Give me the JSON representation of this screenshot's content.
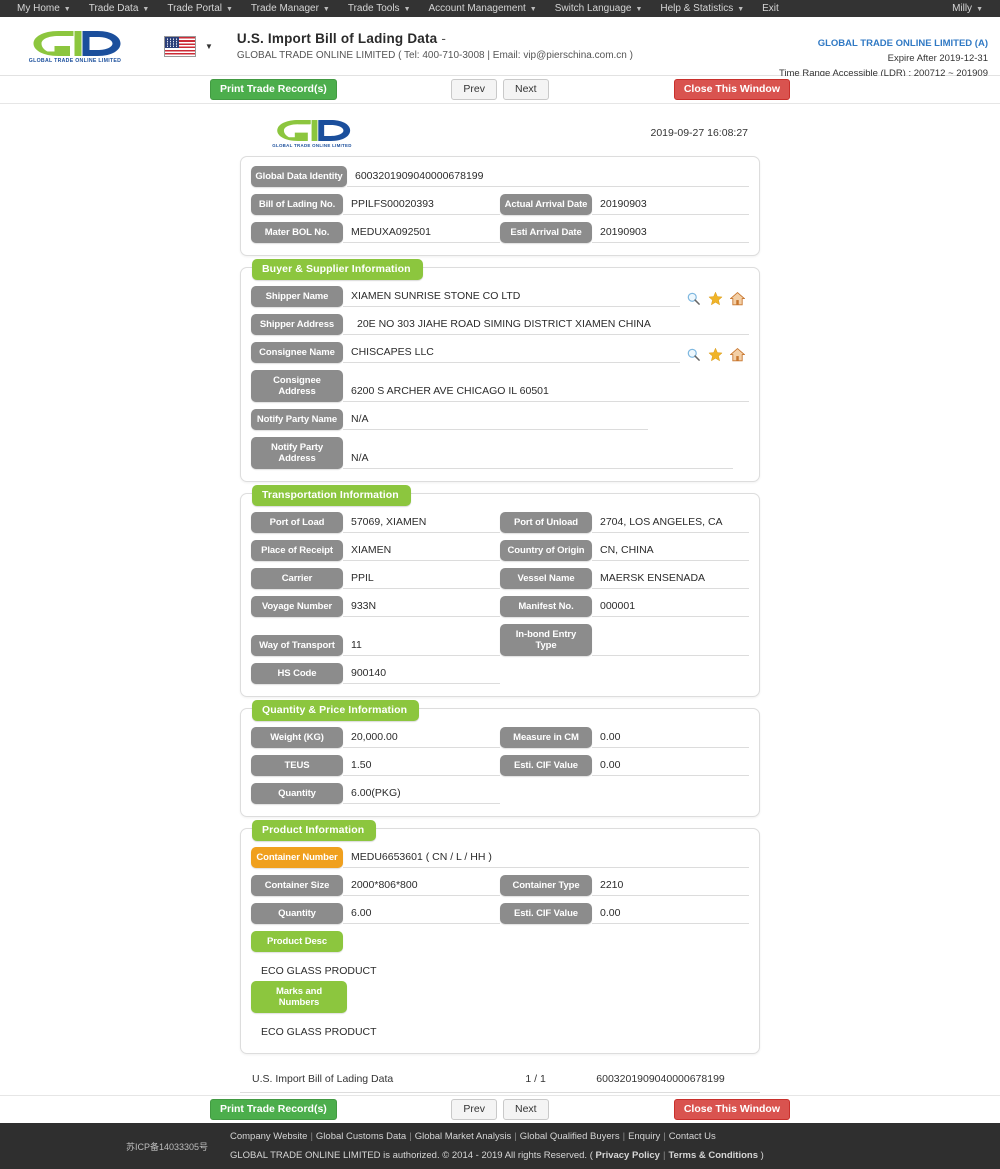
{
  "topnav": {
    "items": [
      {
        "label": "My Home",
        "caret": true
      },
      {
        "label": "Trade Data",
        "caret": true
      },
      {
        "label": "Trade Portal",
        "caret": true
      },
      {
        "label": "Trade Manager",
        "caret": true
      },
      {
        "label": "Trade Tools",
        "caret": true
      },
      {
        "label": "Account Management",
        "caret": true
      },
      {
        "label": "Switch Language",
        "caret": true
      },
      {
        "label": "Help & Statistics",
        "caret": true
      },
      {
        "label": "Exit",
        "caret": false
      }
    ],
    "user": "Milly"
  },
  "header": {
    "logo_sub": "GLOBAL TRADE  ONLINE LIMITED",
    "flag": "us-flag-icon",
    "title": "U.S. Import Bill of Lading Data",
    "title_dash": "-",
    "subtitle": "GLOBAL TRADE ONLINE LIMITED ( Tel: 400-710-3008 | Email: vip@pierschina.com.cn )",
    "account": "GLOBAL TRADE ONLINE LIMITED (A)",
    "expire": "Expire After 2019-12-31",
    "time_range": "Time Range Accessible (LDR) : 200712 ~ 201909"
  },
  "actions": {
    "print": "Print Trade Record(s)",
    "prev": "Prev",
    "next": "Next",
    "close": "Close This Window"
  },
  "doc": {
    "timestamp": "2019-09-27 16:08:27",
    "identity": {
      "label_global_data_identity": "Global Data Identity",
      "value_global_data_identity": "6003201909040000678199",
      "label_bol": "Bill of Lading No.",
      "value_bol": "PPILFS00020393",
      "label_actual_arrival": "Actual Arrival Date",
      "value_actual_arrival": "20190903",
      "label_master_bol": "Mater BOL No.",
      "value_master_bol": "MEDUXA092501",
      "label_esti_arrival": "Esti Arrival Date",
      "value_esti_arrival": "20190903"
    },
    "buyer_supplier": {
      "section_title": "Buyer & Supplier Information",
      "rows": [
        {
          "label": "Shipper Name",
          "value": "XIAMEN SUNRISE STONE CO LTD",
          "icons": true
        },
        {
          "label": "Shipper Address",
          "value": "20E NO 303 JIAHE ROAD SIMING DISTRICT XIAMEN CHINA",
          "icons": false
        },
        {
          "label": "Consignee Name",
          "value": "CHISCAPES LLC",
          "icons": true
        },
        {
          "label": "Consignee Address",
          "value": "6200 S ARCHER AVE CHICAGO IL 60501",
          "icons": false
        },
        {
          "label": "Notify Party Name",
          "value": "N/A",
          "icons": false
        },
        {
          "label": "Notify Party Address",
          "value": "N/A",
          "icons": false
        }
      ]
    },
    "transportation": {
      "section_title": "Transportation Information",
      "rows": [
        {
          "l1": "Port of Load",
          "v1": "57069, XIAMEN",
          "l2": "Port of Unload",
          "v2": "2704, LOS ANGELES, CA"
        },
        {
          "l1": "Place of Receipt",
          "v1": "XIAMEN",
          "l2": "Country of Origin",
          "v2": "CN, CHINA"
        },
        {
          "l1": "Carrier",
          "v1": "PPIL",
          "l2": "Vessel Name",
          "v2": "MAERSK ENSENADA"
        },
        {
          "l1": "Voyage Number",
          "v1": "933N",
          "l2": "Manifest No.",
          "v2": "000001"
        },
        {
          "l1": "Way of Transport",
          "v1": "11",
          "l2": "In-bond Entry Type",
          "v2": ""
        },
        {
          "l1": "HS Code",
          "v1": "900140",
          "l2": "",
          "v2": ""
        }
      ]
    },
    "quantity_price": {
      "section_title": "Quantity & Price Information",
      "rows": [
        {
          "l1": "Weight (KG)",
          "v1": "20,000.00",
          "l2": "Measure in CM",
          "v2": "0.00"
        },
        {
          "l1": "TEUS",
          "v1": "1.50",
          "l2": "Esti. CIF Value",
          "v2": "0.00"
        },
        {
          "l1": "Quantity",
          "v1": "6.00(PKG)",
          "l2": "",
          "v2": ""
        }
      ]
    },
    "product": {
      "section_title": "Product Information",
      "label_container_number": "Container Number",
      "value_container_number": "MEDU6653601 ( CN / L / HH )",
      "rows": [
        {
          "l1": "Container Size",
          "v1": "2000*806*800",
          "l2": "Container Type",
          "v2": "2210"
        },
        {
          "l1": "Quantity",
          "v1": "6.00",
          "l2": "Esti. CIF Value",
          "v2": "0.00"
        }
      ],
      "label_product_desc": "Product Desc",
      "value_product_desc": "ECO GLASS PRODUCT",
      "label_marks": "Marks and Numbers",
      "value_marks": "ECO GLASS PRODUCT"
    },
    "footer": {
      "doc_title": "U.S. Import Bill of Lading Data",
      "page": "1 / 1",
      "identity": "6003201909040000678199"
    }
  },
  "pagefooter": {
    "icp": "苏ICP备14033305号",
    "links": [
      "Company Website",
      "Global Customs Data",
      "Global Market Analysis",
      "Global Qualified Buyers",
      "Enquiry",
      "Contact Us"
    ],
    "copyright": "GLOBAL TRADE ONLINE LIMITED is authorized. © 2014 - 2019 All rights Reserved.",
    "paren_open": "(",
    "privacy": "Privacy Policy",
    "terms": "Terms & Conditions",
    "paren_close": ")"
  },
  "colors": {
    "accent_green": "#8cc63e",
    "label_gray": "#8c8c8c",
    "orange": "#f0a01e",
    "btn_green": "#4cae4c",
    "btn_red": "#d9534f",
    "link_blue": "#3079c4",
    "nav_dark": "#333333"
  }
}
